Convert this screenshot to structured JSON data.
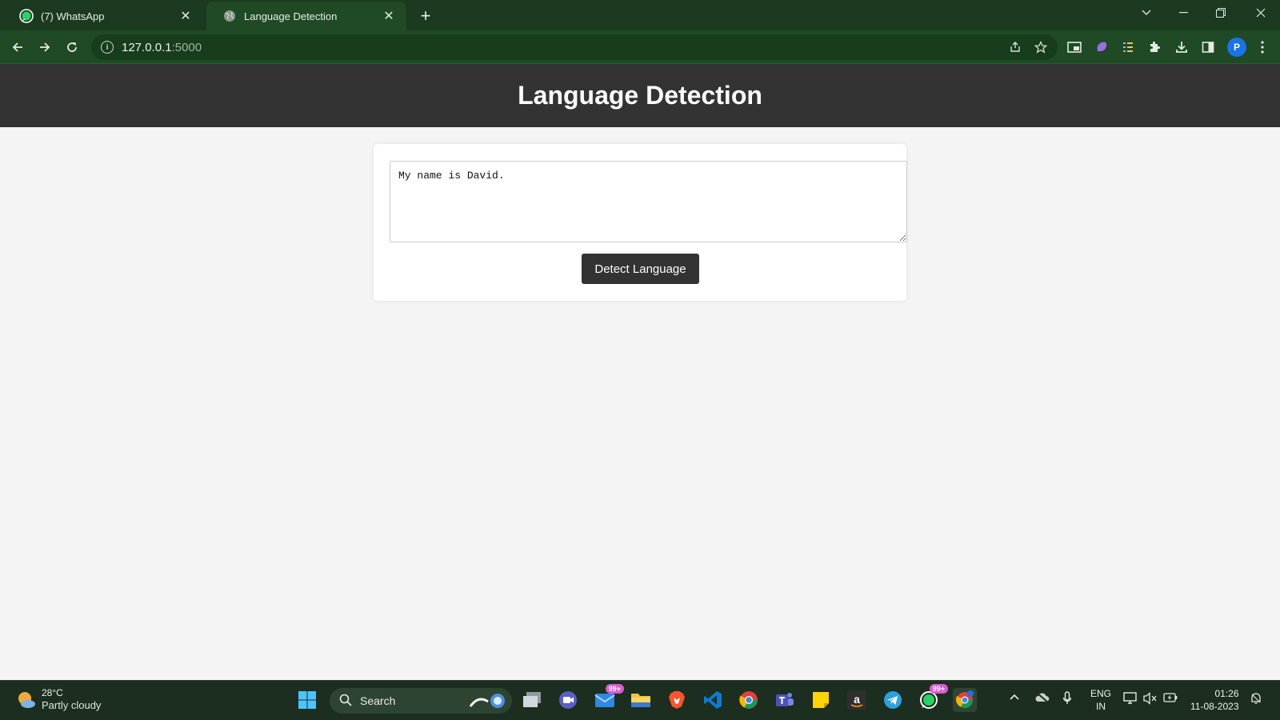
{
  "browser": {
    "tabs": [
      {
        "title": "(7) WhatsApp",
        "icon": "whatsapp-icon",
        "active": false
      },
      {
        "title": "Language Detection",
        "icon": "globe-icon",
        "active": true
      }
    ],
    "address": {
      "host": "127.0.0.1",
      "port": ":5000"
    }
  },
  "page": {
    "header_title": "Language Detection",
    "textarea_value": "My name is David.",
    "detect_button_label": "Detect Language"
  },
  "taskbar": {
    "weather": {
      "temp": "28°C",
      "condition": "Partly cloudy"
    },
    "search_label": "Search",
    "mail_badge": "99+",
    "whatsapp_badge": "99+",
    "language": {
      "line1": "ENG",
      "line2": "IN"
    },
    "clock": {
      "time": "01:26",
      "date": "11-08-2023"
    }
  },
  "colors": {
    "chrome_dark": "#1b3a1f",
    "chrome_toolbar": "#1f4a25",
    "page_header": "#333333",
    "page_bg": "#f4f4f4",
    "button_bg": "#333333"
  }
}
